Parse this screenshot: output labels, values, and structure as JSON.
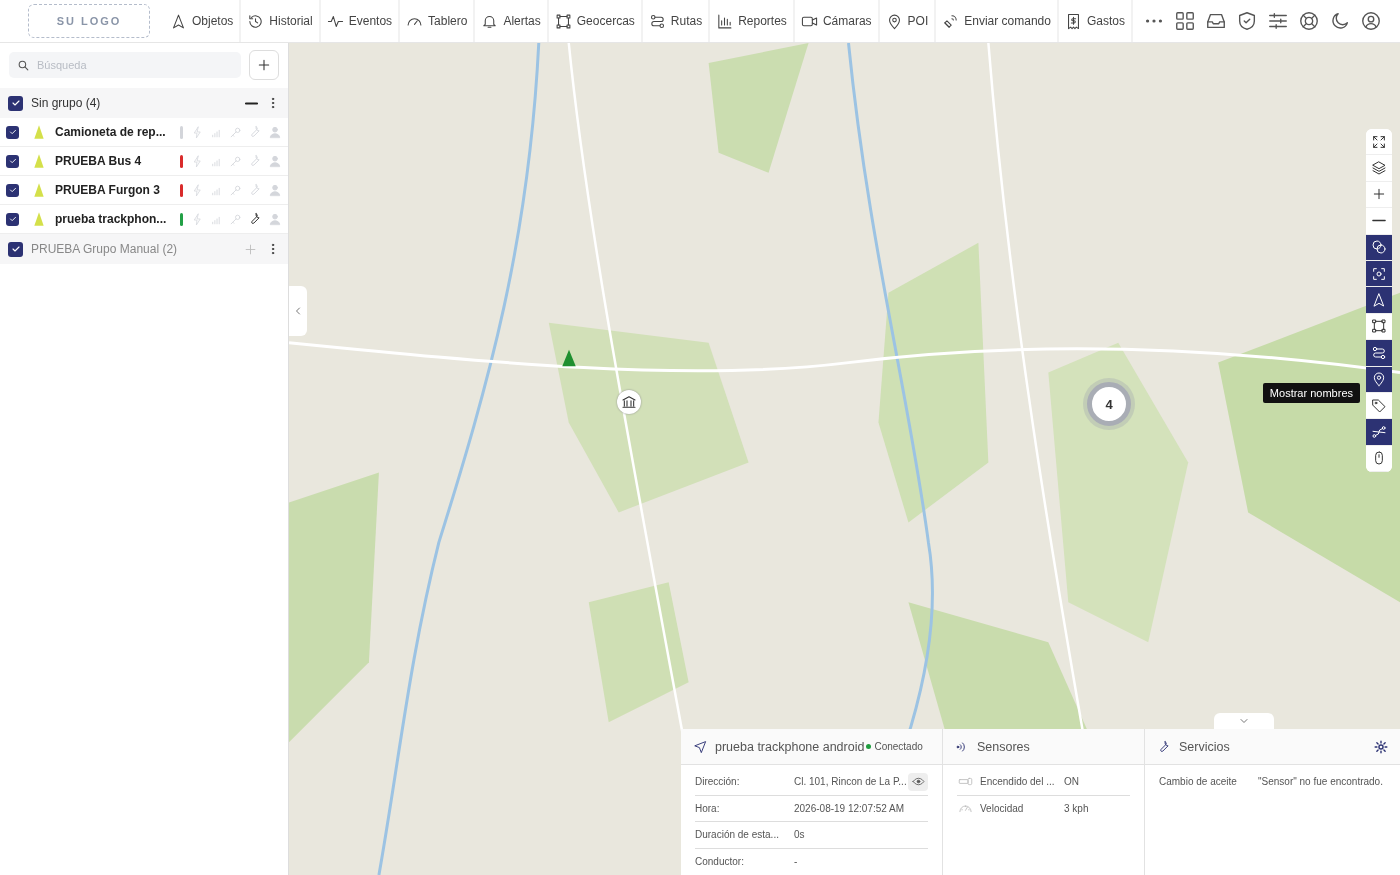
{
  "logo": "SU LOGO",
  "nav": [
    {
      "label": "Objetos"
    },
    {
      "label": "Historial"
    },
    {
      "label": "Eventos"
    },
    {
      "label": "Tablero"
    },
    {
      "label": "Alertas"
    },
    {
      "label": "Geocercas"
    },
    {
      "label": "Rutas"
    },
    {
      "label": "Reportes"
    },
    {
      "label": "Cámaras"
    },
    {
      "label": "POI"
    },
    {
      "label": "Enviar comando"
    },
    {
      "label": "Gastos"
    }
  ],
  "sidebar": {
    "search": {
      "placeholder": "Búsqueda"
    },
    "groups": [
      {
        "name": "Sin grupo (4)",
        "checked": true,
        "expanded": true,
        "items": [
          {
            "name": "Camioneta de rep...",
            "checked": true,
            "color": "#d3d5da",
            "service_active": false
          },
          {
            "name": "PRUEBA Bus 4",
            "checked": true,
            "color": "#d92b2b",
            "service_active": false
          },
          {
            "name": "PRUEBA Furgon 3",
            "checked": true,
            "color": "#d92b2b",
            "service_active": false
          },
          {
            "name": "prueba trackphon...",
            "checked": true,
            "color": "#22a046",
            "service_active": true
          }
        ]
      },
      {
        "name": "PRUEBA Grupo Manual (2)",
        "checked": true,
        "expanded": false
      }
    ]
  },
  "map": {
    "cluster": "4",
    "controls": [
      {
        "selected": false
      },
      {
        "selected": false
      },
      {
        "selected": false
      },
      {
        "selected": false
      },
      {
        "selected": true
      },
      {
        "selected": true
      },
      {
        "selected": true
      },
      {
        "selected": false
      },
      {
        "selected": true
      },
      {
        "selected": true
      },
      {
        "selected": false
      },
      {
        "selected": true
      },
      {
        "selected": false
      }
    ],
    "tooltip": "Mostrar nombres"
  },
  "info": {
    "object": {
      "name": "prueba trackphone android",
      "status": "Conectado",
      "color": "#1f9d3f",
      "rows": [
        {
          "label": "Dirección:",
          "value": "Cl. 101, Rincon de La P...",
          "kind": "address"
        },
        {
          "label": "Hora:",
          "value": "2026-08-19 12:07:52 AM",
          "kind": "text"
        },
        {
          "label": "Duración de esta...",
          "value": "0s",
          "kind": "text"
        },
        {
          "label": "Conductor:",
          "value": "-",
          "kind": "text"
        }
      ]
    },
    "sensors": {
      "title": "Sensores",
      "rows": [
        {
          "label": "Encendido del ...",
          "value": "ON",
          "kind": "ignition"
        },
        {
          "label": "Velocidad",
          "value": "3 kph",
          "kind": "speed"
        }
      ]
    },
    "services": {
      "title": "Servicios",
      "rows": [
        {
          "label": "Cambio de aceite",
          "value": "\"Sensor\" no fue encontrado."
        }
      ]
    }
  }
}
